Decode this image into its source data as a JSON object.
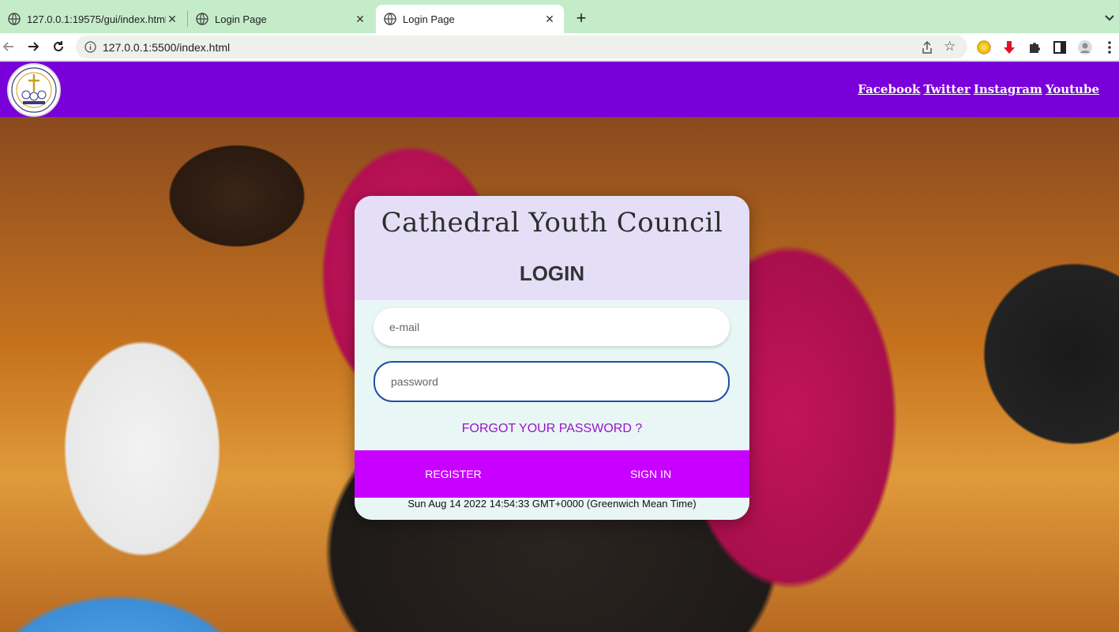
{
  "browser": {
    "tabs": [
      {
        "title": "127.0.0.1:19575/gui/index.html"
      },
      {
        "title": "Login Page"
      },
      {
        "title": "Login Page",
        "active": true
      }
    ],
    "new_tab_label": "+",
    "url": "127.0.0.1:5500/index.html",
    "star": "☆"
  },
  "header": {
    "logo_icon": "cyc-logo-icon",
    "social_links": [
      "Facebook",
      "Twitter",
      "Instagram",
      "Youtube"
    ]
  },
  "login": {
    "brand": "Cathedral Youth Council",
    "title": "LOGIN",
    "email_placeholder": "e-mail",
    "password_placeholder": "password",
    "forgot_label": "FORGOT YOUR PASSWORD ?",
    "register_label": "REGISTER",
    "signin_label": "SIGN IN",
    "datetime": "Sun Aug 14 2022 14:54:33 GMT+0000 (Greenwich Mean Time)"
  },
  "colors": {
    "header_bg": "#7a00d9",
    "button_bar": "#c800ff",
    "forgot_link": "#9a14c8",
    "card_head": "#e4def7",
    "card_body": "#e9f6f6",
    "tabstrip": "#c5ecc9"
  }
}
